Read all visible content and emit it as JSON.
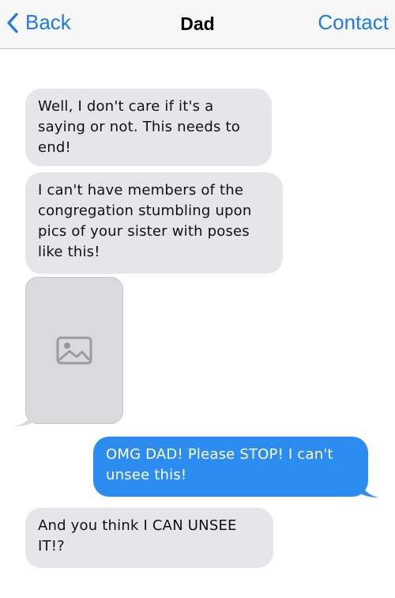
{
  "header": {
    "back_label": "Back",
    "title": "Dad",
    "contact_label": "Contact"
  },
  "colors": {
    "accent": "#1f7ae6",
    "incoming_bubble": "#e5e5ea",
    "outgoing_bubble": "#2d8cf0"
  },
  "messages": [
    {
      "from": "Dad",
      "type": "text",
      "text": "Well, I don't care if it's a saying or not. This needs to end!"
    },
    {
      "from": "Dad",
      "type": "text",
      "text": "I can't have members of the congregation stumbling upon pics of your sister with poses like this!"
    },
    {
      "from": "Dad",
      "type": "image"
    },
    {
      "from": "me",
      "type": "text",
      "text": "OMG DAD! Please STOP! I can't unsee this!"
    },
    {
      "from": "Dad",
      "type": "text",
      "text": "And you think I CAN UNSEE IT!?"
    }
  ]
}
